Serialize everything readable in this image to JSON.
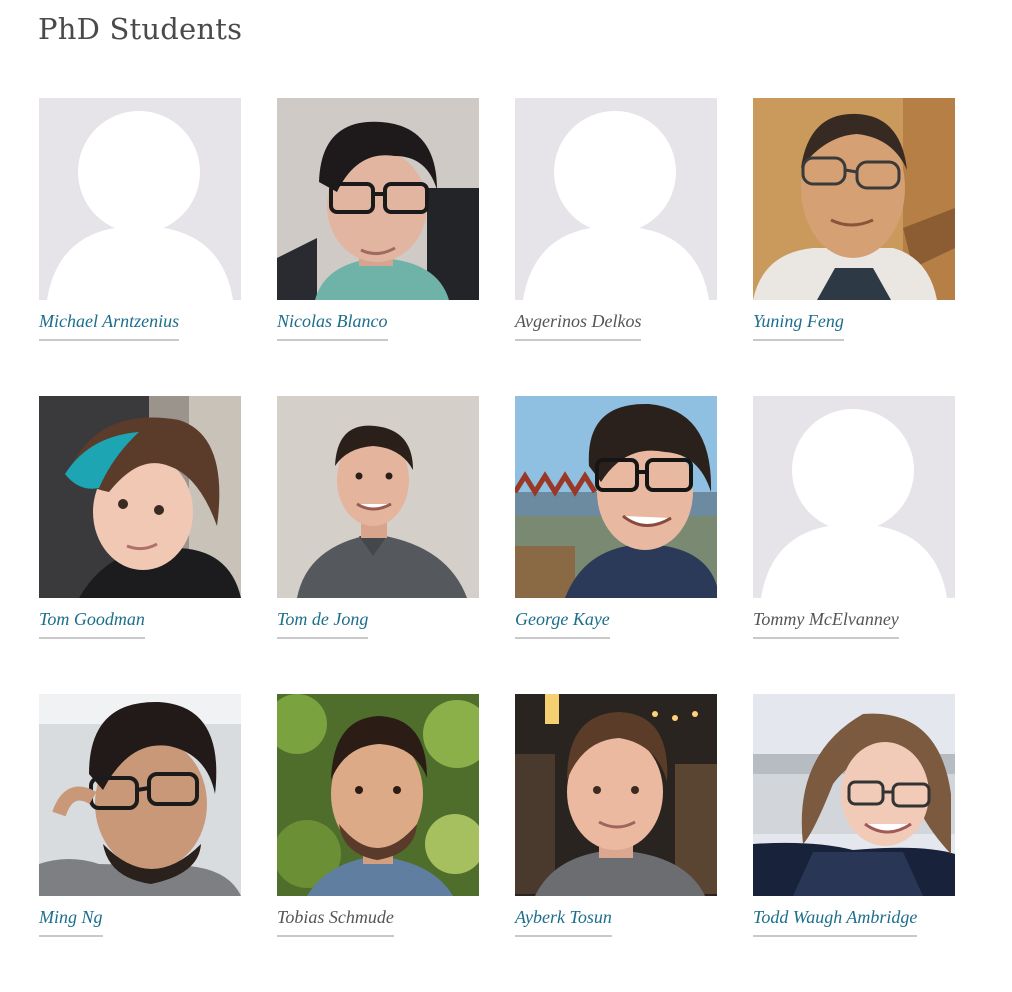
{
  "page": {
    "title": "PhD Students"
  },
  "students": [
    {
      "name": "Michael Arntzenius",
      "linked": true,
      "photo": "placeholder-avatar"
    },
    {
      "name": "Nicolas Blanco",
      "linked": true,
      "photo": "portrait"
    },
    {
      "name": "Avgerinos Delkos",
      "linked": false,
      "photo": "placeholder-avatar"
    },
    {
      "name": "Yuning Feng",
      "linked": true,
      "photo": "portrait"
    },
    {
      "name": "Tom Goodman",
      "linked": true,
      "photo": "portrait"
    },
    {
      "name": "Tom de Jong",
      "linked": true,
      "photo": "portrait"
    },
    {
      "name": "George Kaye",
      "linked": true,
      "photo": "portrait"
    },
    {
      "name": "Tommy McElvanney",
      "linked": false,
      "photo": "placeholder-avatar"
    },
    {
      "name": "Ming Ng",
      "linked": true,
      "photo": "portrait"
    },
    {
      "name": "Tobias Schmude",
      "linked": false,
      "photo": "portrait"
    },
    {
      "name": "Ayberk Tosun",
      "linked": true,
      "photo": "portrait"
    },
    {
      "name": "Todd Waugh Ambridge",
      "linked": true,
      "photo": "portrait"
    }
  ],
  "colors": {
    "link": "#1c6e8c",
    "plain_text": "#555555",
    "title": "#4a4a4a",
    "placeholder_bg": "#e6e4e8",
    "underline": "#c9c9c9"
  }
}
